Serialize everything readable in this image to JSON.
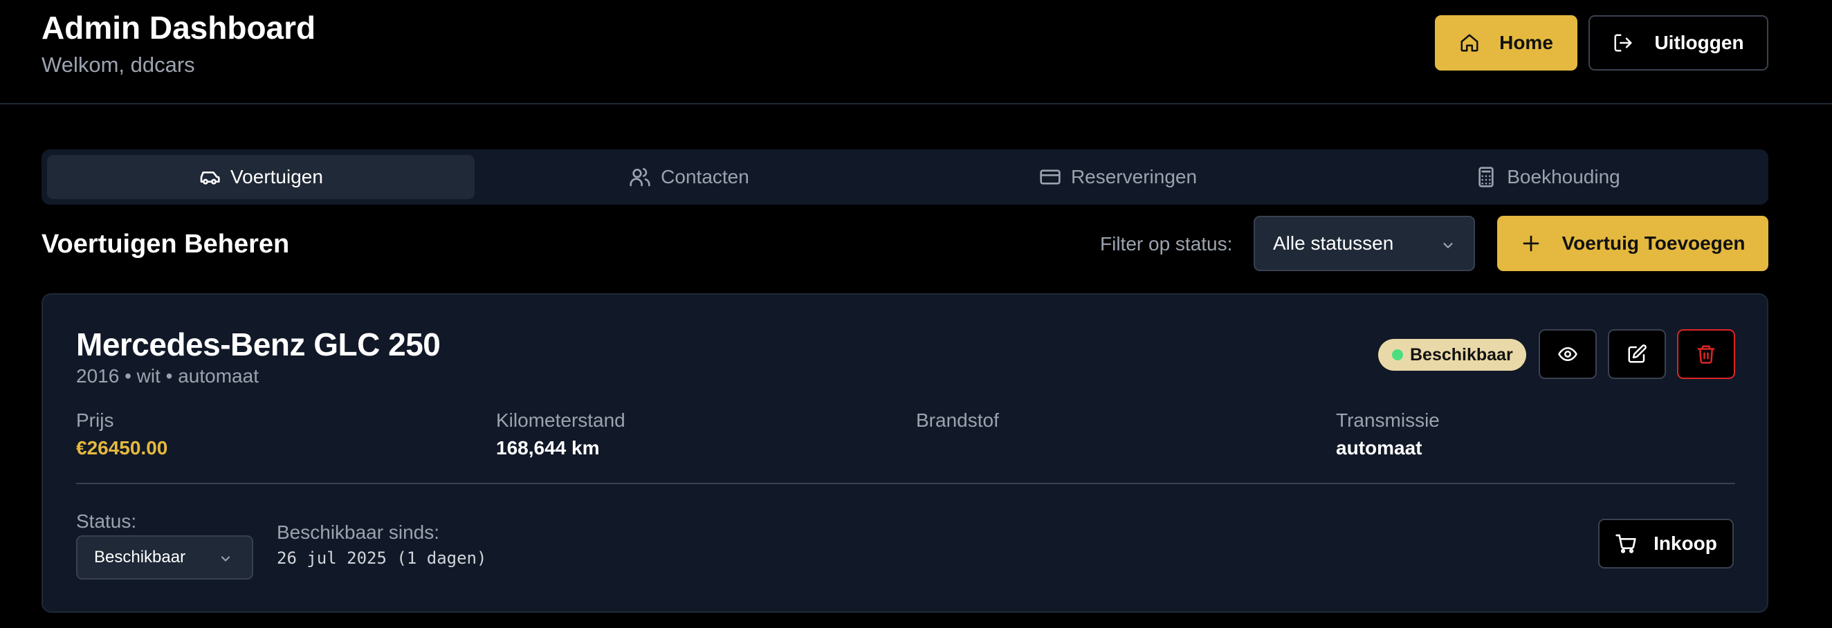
{
  "header": {
    "title": "Admin Dashboard",
    "subtitle": "Welkom, ddcars",
    "home_label": "Home",
    "logout_label": "Uitloggen"
  },
  "tabs": [
    {
      "label": "Voertuigen",
      "icon": "car-icon",
      "active": true
    },
    {
      "label": "Contacten",
      "icon": "users-icon",
      "active": false
    },
    {
      "label": "Reserveringen",
      "icon": "credit-card-icon",
      "active": false
    },
    {
      "label": "Boekhouding",
      "icon": "calculator-icon",
      "active": false
    }
  ],
  "section": {
    "title": "Voertuigen Beheren",
    "filter_label": "Filter op status:",
    "filter_value": "Alle statussen",
    "add_label": "Voertuig Toevoegen"
  },
  "vehicle": {
    "name": "Mercedes-Benz GLC 250",
    "meta": "2016 • wit • automaat",
    "status_badge": "Beschikbaar",
    "specs": {
      "price_label": "Prijs",
      "price_value": "€26450.00",
      "km_label": "Kilometerstand",
      "km_value": "168,644 km",
      "fuel_label": "Brandstof",
      "fuel_value": "",
      "transmission_label": "Transmissie",
      "transmission_value": "automaat"
    },
    "status_label": "Status:",
    "status_value": "Beschikbaar",
    "since_label": "Beschikbaar sinds:",
    "since_value": "26 jul 2025 (1 dagen)",
    "purchase_label": "Inkoop"
  },
  "colors": {
    "accent": "#e5b93f",
    "background": "#000000",
    "card": "#111827",
    "danger": "#dc2626",
    "available_dot": "#4ade80"
  }
}
